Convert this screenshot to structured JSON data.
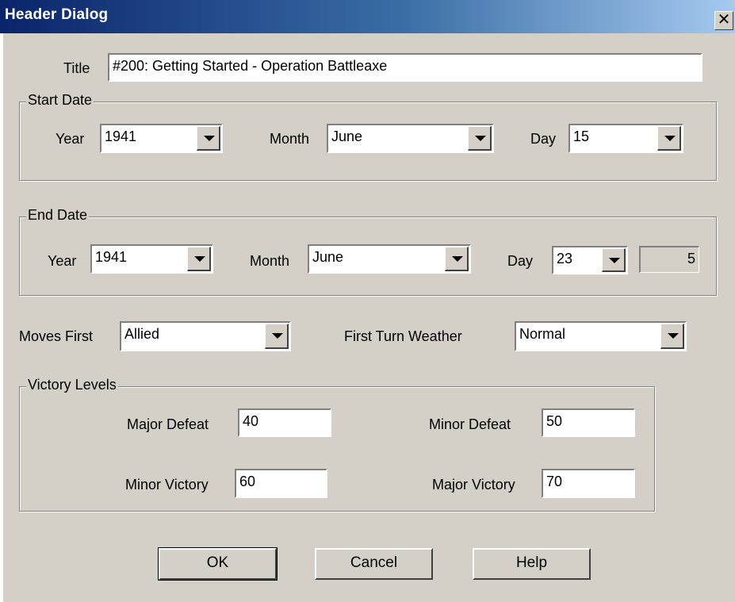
{
  "window": {
    "title": "Header Dialog",
    "close_glyph": "✕"
  },
  "title_field": {
    "label": "Title",
    "value": "#200: Getting Started - Operation Battleaxe"
  },
  "start_date": {
    "legend": "Start Date",
    "year_label": "Year",
    "year": "1941",
    "month_label": "Month",
    "month": "June",
    "day_label": "Day",
    "day": "15"
  },
  "end_date": {
    "legend": "End Date",
    "year_label": "Year",
    "year": "1941",
    "month_label": "Month",
    "month": "June",
    "day_label": "Day",
    "day": "23",
    "turns": "5"
  },
  "moves_first": {
    "label": "Moves First",
    "value": "Allied"
  },
  "weather": {
    "label": "First Turn Weather",
    "value": "Normal"
  },
  "victory": {
    "legend": "Victory Levels",
    "major_defeat_label": "Major Defeat",
    "major_defeat": "40",
    "minor_defeat_label": "Minor Defeat",
    "minor_defeat": "50",
    "minor_victory_label": "Minor Victory",
    "minor_victory": "60",
    "major_victory_label": "Major Victory",
    "major_victory": "70"
  },
  "buttons": {
    "ok": "OK",
    "cancel": "Cancel",
    "help": "Help"
  },
  "icons": {
    "dropdown": "chevron-down-icon",
    "close": "close-icon"
  }
}
